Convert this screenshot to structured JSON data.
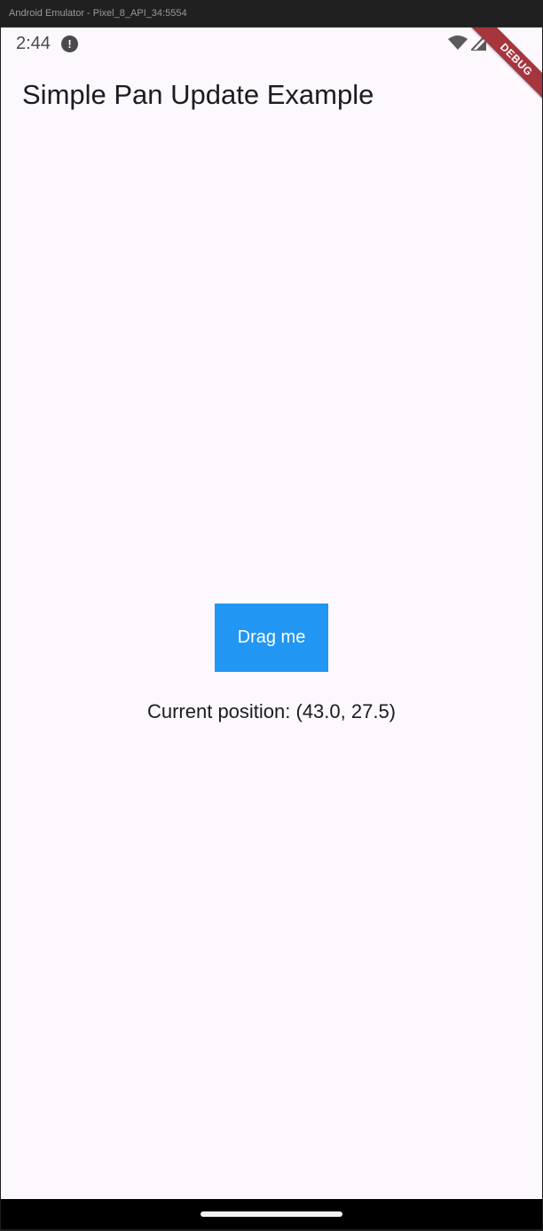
{
  "window": {
    "title": "Android Emulator - Pixel_8_API_34:5554"
  },
  "status_bar": {
    "time": "2:44",
    "alert_icon": "exclamation-circle-icon",
    "alert_glyph": "!",
    "wifi_icon": "wifi-icon",
    "signal_icon": "cell-signal-icon"
  },
  "debug_banner": {
    "label": "DEBUG",
    "color": "#a5363d"
  },
  "app_bar": {
    "title": "Simple Pan Update Example"
  },
  "main": {
    "drag_label": "Drag me",
    "drag_color": "#2196f3",
    "position_text": "Current position: (43.0, 27.5)"
  },
  "colors": {
    "background": "#fdf7fe",
    "text": "#1c1b1f"
  }
}
